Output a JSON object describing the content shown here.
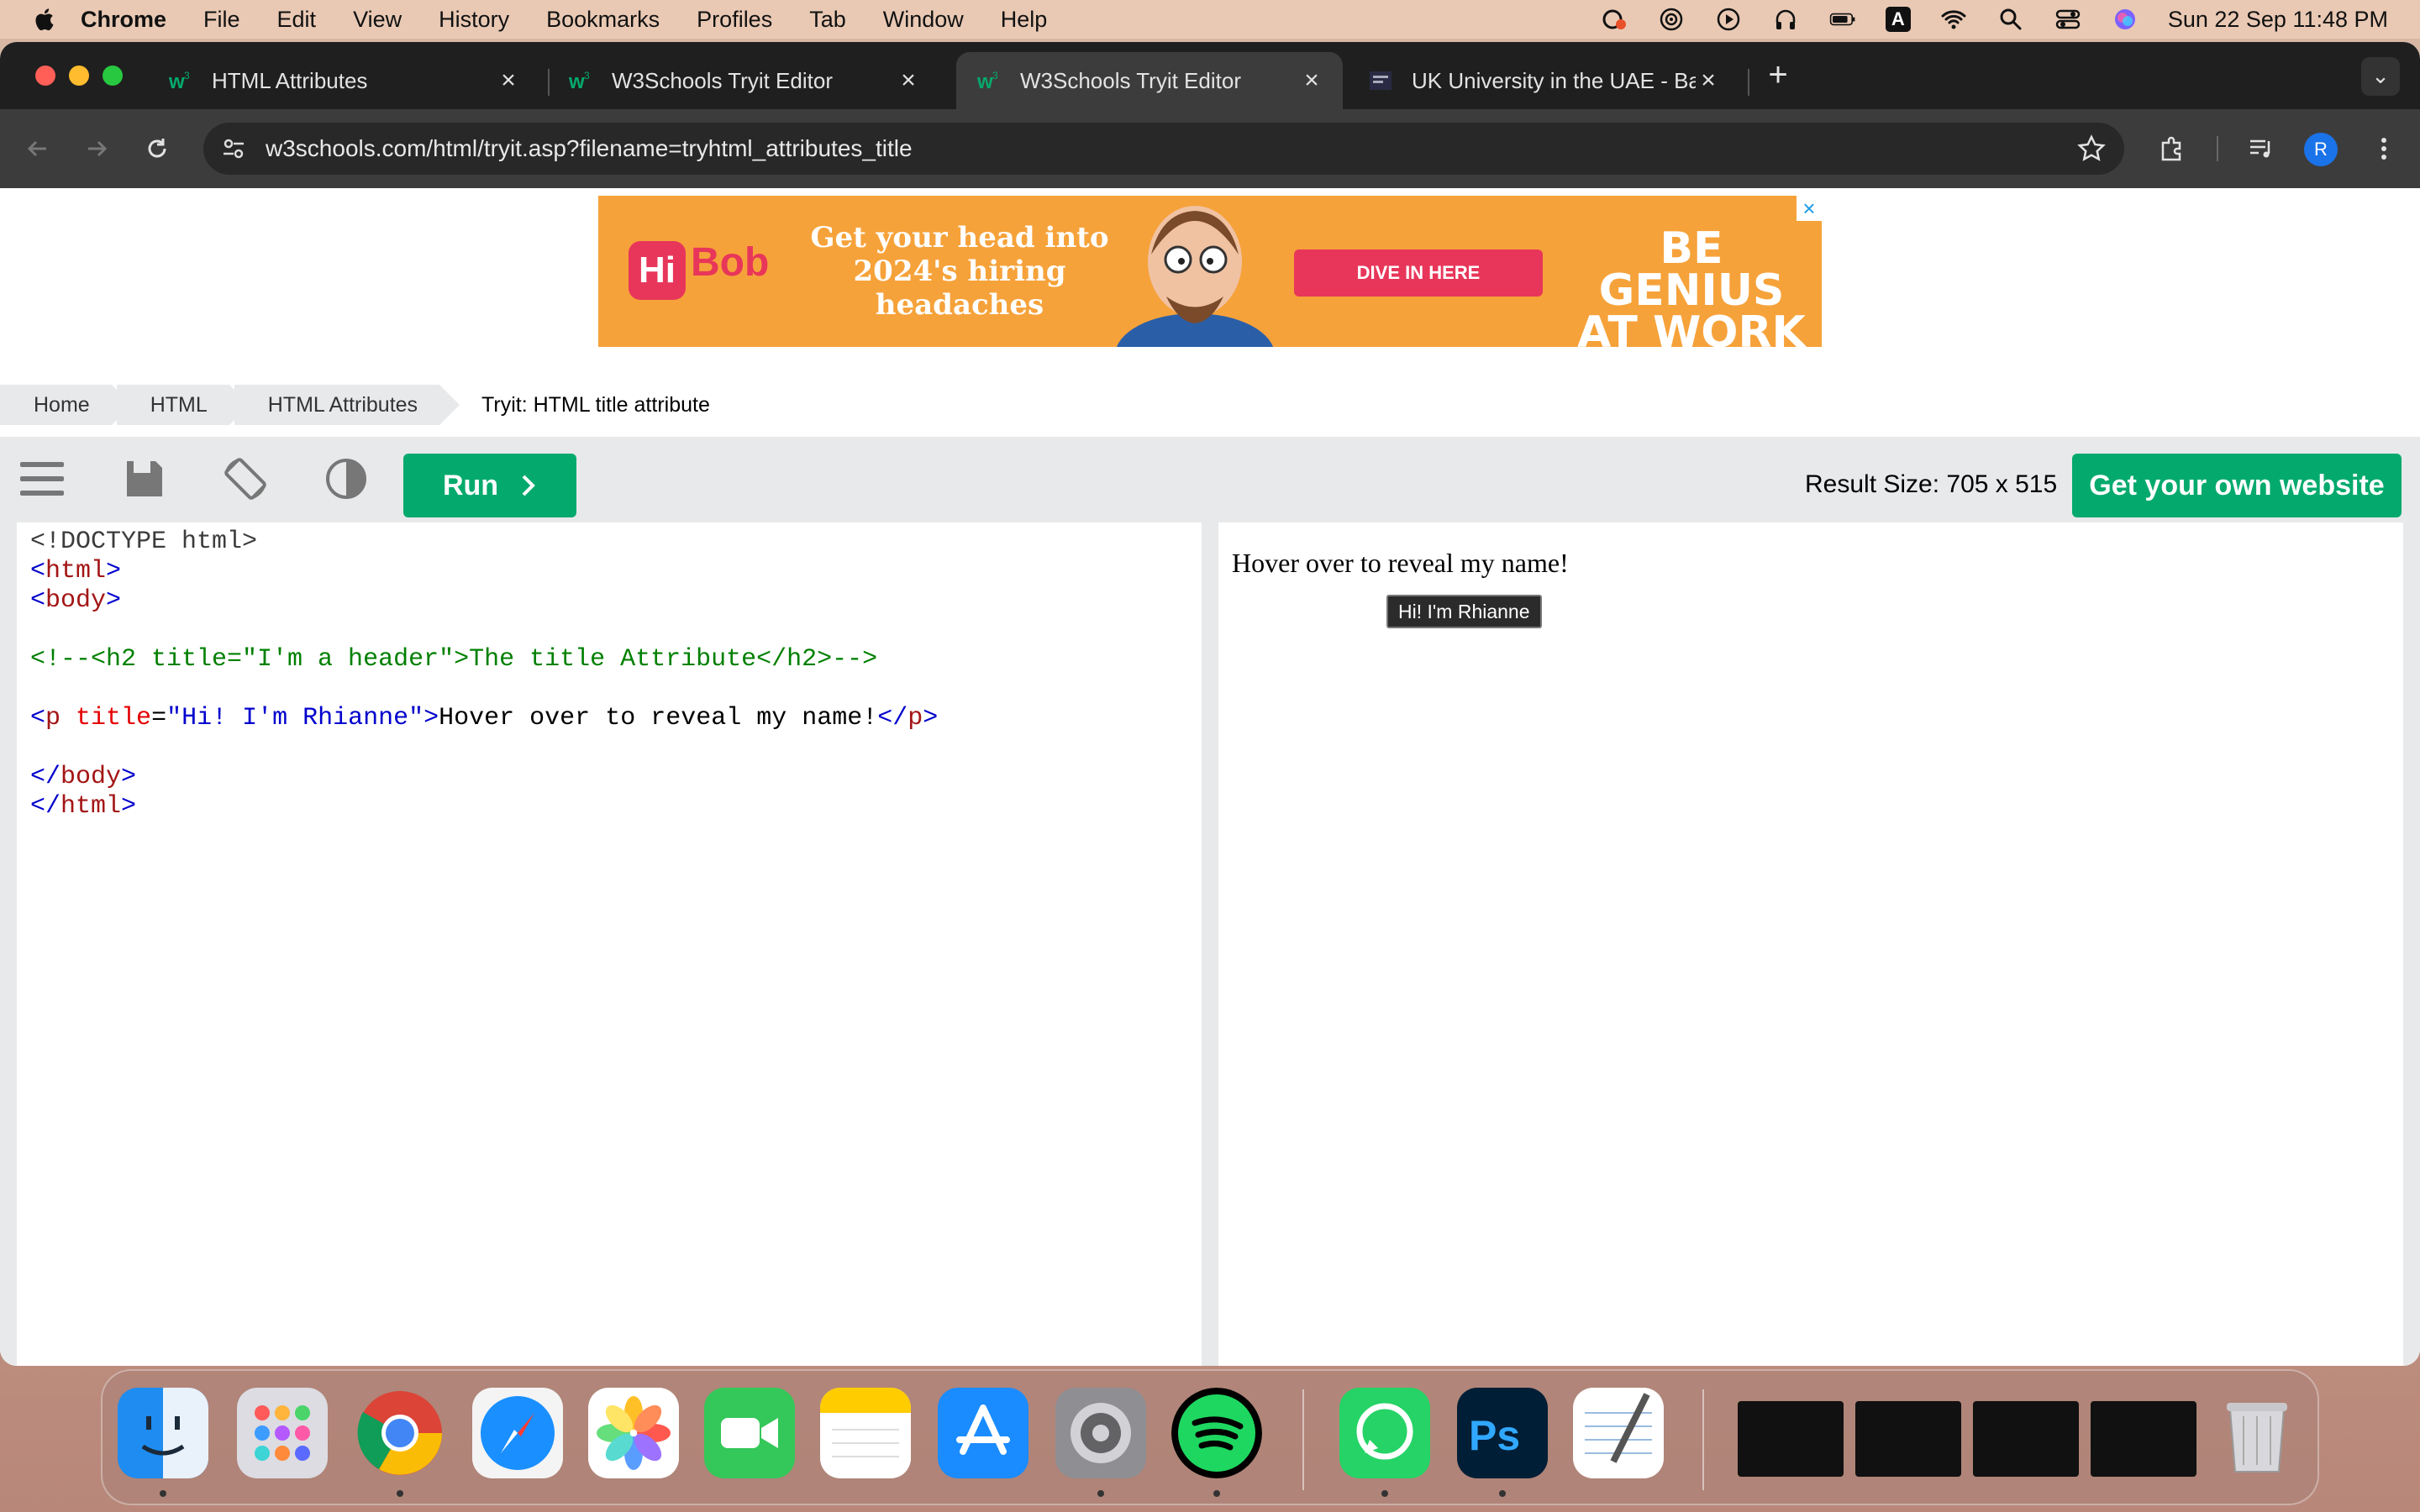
{
  "menubar": {
    "app_name": "Chrome",
    "items": [
      "File",
      "Edit",
      "View",
      "History",
      "Bookmarks",
      "Profiles",
      "Tab",
      "Window",
      "Help"
    ],
    "clock": "Sun 22 Sep  11:48 PM",
    "input_indicator": "A"
  },
  "tabs": [
    {
      "title": "HTML Attributes"
    },
    {
      "title": "W3Schools Tryit Editor"
    },
    {
      "title": "W3Schools Tryit Editor"
    },
    {
      "title": "UK University in the UAE - Ba"
    }
  ],
  "toolbar": {
    "url": "w3schools.com/html/tryit.asp?filename=tryhtml_attributes_title",
    "profile_initial": "R"
  },
  "ad": {
    "brand_hi": "Hi",
    "brand_bob": "Bob",
    "tagline": "Get your head into 2024's hiring headaches",
    "cta": "DIVE IN HERE",
    "slogan": "BE GENIUS AT WORK"
  },
  "breadcrumb": [
    "Home",
    "HTML",
    "HTML Attributes",
    "Tryit: HTML title attribute"
  ],
  "tryit": {
    "run_label": "Run",
    "result_size": "Result Size: 705 x 515",
    "own_website": "Get your own website"
  },
  "code": {
    "line1": "<!DOCTYPE html>",
    "line2_tag": "html",
    "line3_tag": "body",
    "line5_comment": "<!--<h2 title=\"I'm a header\">The title Attribute</h2>-->",
    "line7_open": "p",
    "line7_attr": "title",
    "line7_val": "\"Hi! I'm Rhianne\"",
    "line7_text": "Hover over to reveal my name!",
    "line7_close": "p",
    "line9_tag": "body",
    "line10_tag": "html"
  },
  "result": {
    "text": "Hover over to reveal my name!",
    "tooltip": "Hi! I'm Rhianne"
  },
  "colors": {
    "w3_green": "#04aa6d",
    "chrome_dark": "#1f1f1f",
    "ad_orange": "#f6a23a",
    "hibob_pink": "#e8365a"
  }
}
